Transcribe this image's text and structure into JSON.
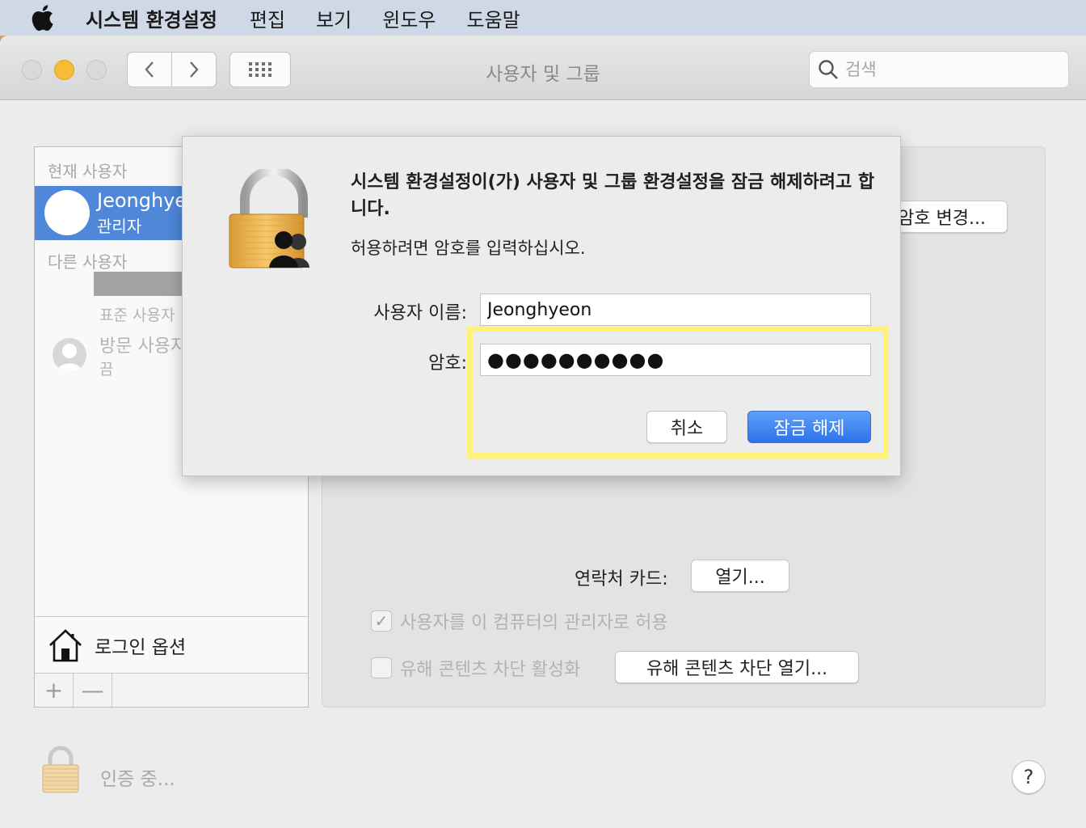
{
  "menubar": {
    "apple_icon": "apple-logo-icon",
    "app_name": "시스템 환경설정",
    "items": [
      "편집",
      "보기",
      "윈도우",
      "도움말"
    ]
  },
  "window": {
    "title": "사용자 및 그룹",
    "search_placeholder": "검색"
  },
  "sidebar": {
    "current_users_label": "현재 사용자",
    "current_user": {
      "name": "Jeonghyeon",
      "role": "관리자"
    },
    "other_users_label": "다른 사용자",
    "other_user_role": "표준 사용자",
    "guest": {
      "name": "방문 사용자",
      "status": "끔"
    },
    "login_options": "로그인 옵션",
    "add_button": "+",
    "remove_button": "—"
  },
  "detail": {
    "change_password_button": "암호 변경...",
    "contacts_label": "연락처 카드:",
    "contacts_open_button": "열기...",
    "admin_checkbox_label": "사용자를 이 컴퓨터의 관리자로 허용",
    "admin_checked": true,
    "parental_checkbox_label": "유해 콘텐츠 차단 활성화",
    "parental_checked": false,
    "parental_open_button": "유해 콘텐츠 차단 열기..."
  },
  "footer": {
    "auth_status": "인증 중...",
    "help_button": "?"
  },
  "auth_dialog": {
    "title": "시스템 환경설정이(가) 사용자 및 그룹 환경설정을 잠금 해제하려고 합니다.",
    "subtitle": "허용하려면 암호를 입력하십시오.",
    "username_label": "사용자 이름:",
    "username_value": "Jeonghyeon",
    "password_label": "암호:",
    "password_value": "●●●●●●●●●●",
    "cancel_button": "취소",
    "unlock_button": "잠금 해제",
    "highlight_color": "#fff27a",
    "accent_color": "#2d72ec"
  }
}
